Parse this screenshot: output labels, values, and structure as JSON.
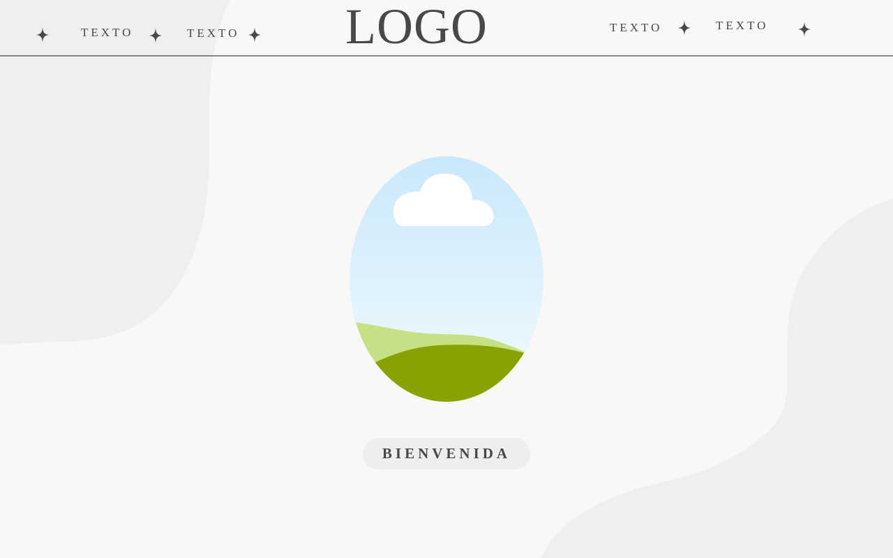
{
  "brand": {
    "logo_text": "LOGO"
  },
  "nav": {
    "items": [
      {
        "label": "TEXTO"
      },
      {
        "label": "TEXTO"
      },
      {
        "label": "TEXTO"
      },
      {
        "label": "TEXTO"
      }
    ]
  },
  "hero": {
    "image_icon": "landscape-illustration",
    "welcome_label": "BIENVENIDA"
  },
  "theme": {
    "background": "#f9f8f6",
    "blob": "#f0efed",
    "text": "#4a4846",
    "sky_top": "#c9e8fb",
    "sky_bottom": "#f2fbfe",
    "hill_light": "#c5e085",
    "hill_dark": "#88a300",
    "cloud": "#ffffff"
  }
}
